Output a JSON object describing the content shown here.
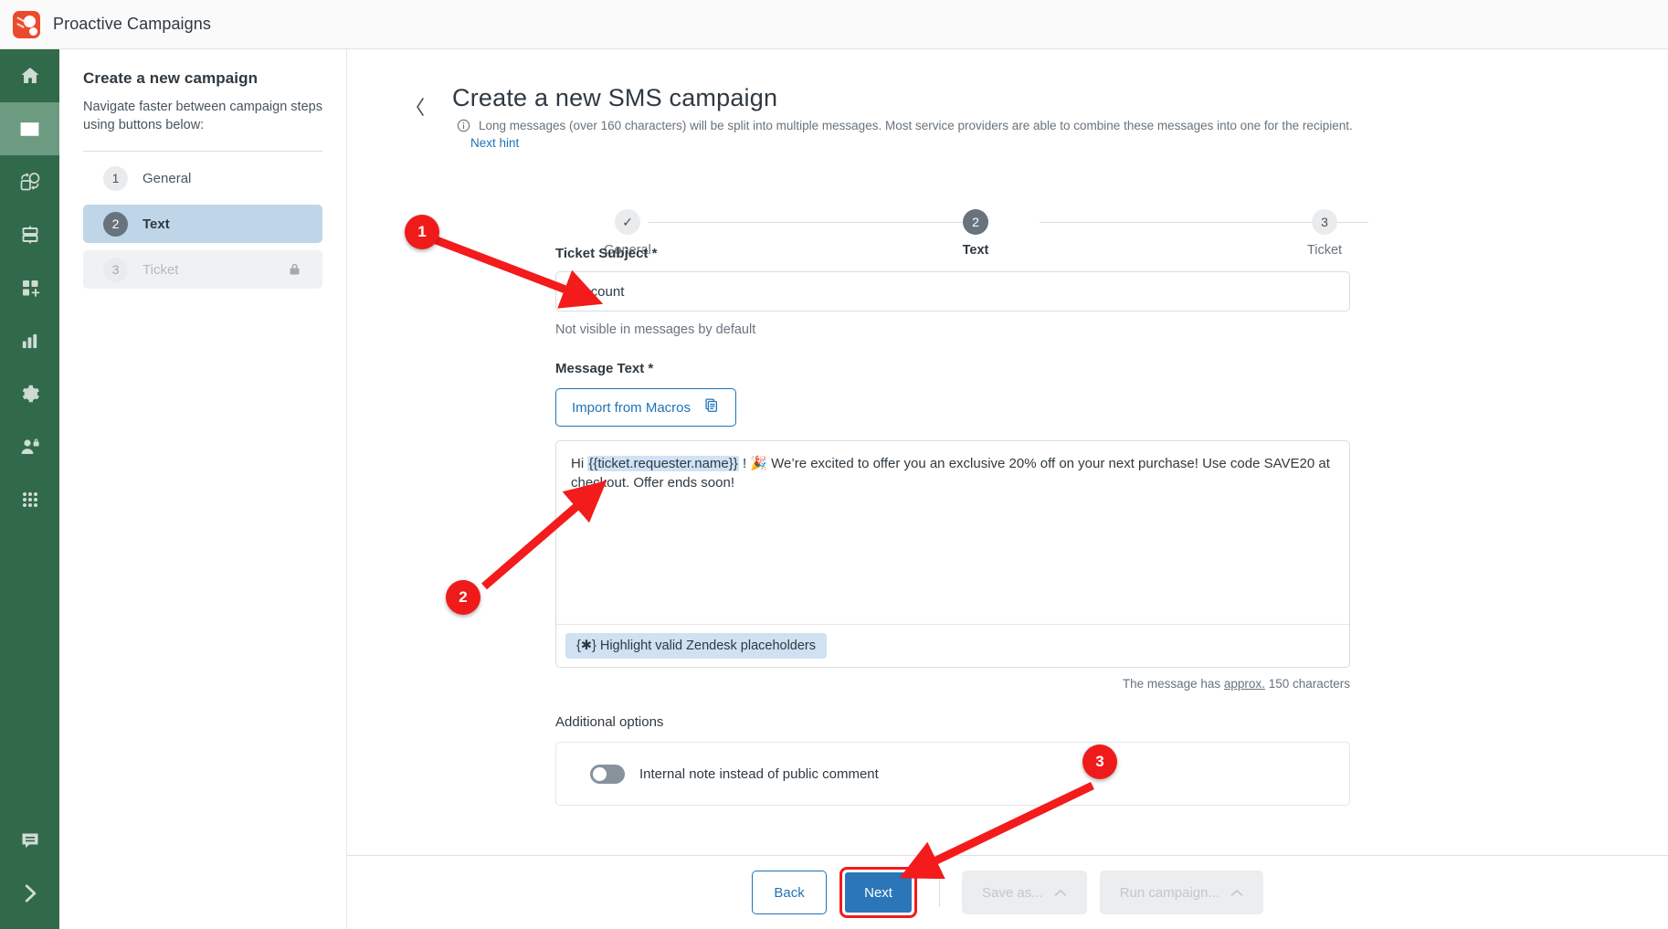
{
  "topbar": {
    "title": "Proactive Campaigns",
    "logo_icon": "proactive-campaigns-logo"
  },
  "rail": {
    "items": [
      {
        "icon": "home-icon",
        "name": "home"
      },
      {
        "icon": "envelope-icon",
        "name": "campaigns"
      },
      {
        "icon": "automation-icon",
        "name": "automations"
      },
      {
        "icon": "database-icon",
        "name": "data"
      },
      {
        "icon": "add-apps-icon",
        "name": "add-apps"
      },
      {
        "icon": "bar-chart-icon",
        "name": "reports"
      },
      {
        "icon": "gear-icon",
        "name": "settings"
      },
      {
        "icon": "user-lock-icon",
        "name": "permissions"
      },
      {
        "icon": "grid-dots-icon",
        "name": "apps"
      }
    ],
    "bottom": [
      {
        "icon": "chat-icon",
        "name": "support-chat"
      },
      {
        "icon": "chevron-right-icon",
        "name": "expand-sidebar"
      }
    ]
  },
  "subnav": {
    "heading": "Create a new campaign",
    "description": "Navigate faster between campaign steps using buttons below:",
    "steps": [
      {
        "num": "1",
        "label": "General",
        "state": "done"
      },
      {
        "num": "2",
        "label": "Text",
        "state": "active"
      },
      {
        "num": "3",
        "label": "Ticket",
        "state": "locked",
        "icon": "lock-icon"
      }
    ]
  },
  "main": {
    "back_icon": "chevron-left-icon",
    "title": "Create a new SMS campaign",
    "hint_icon": "info-icon",
    "hint": "Long messages (over 160 characters) will be split into multiple messages. Most service providers are able to combine these messages into one for the recipient.",
    "hint_link": "Next hint",
    "stepper": [
      {
        "num": "✓",
        "label": "General",
        "state": "done"
      },
      {
        "num": "2",
        "label": "Text",
        "state": "current"
      },
      {
        "num": "3",
        "label": "Ticket",
        "state": "upcoming"
      }
    ],
    "subject": {
      "label": "Ticket Subject *",
      "value": "Discount",
      "placeholder": "Ticket Subject",
      "help": "Not visible in messages by default"
    },
    "message": {
      "label": "Message Text *",
      "macros_button": "Import from Macros",
      "macros_icon": "copy-icon",
      "text_before_placeholder": "Hi ",
      "placeholder_token": "{{ticket.requester.name}}",
      "text_after_placeholder": " ! 🎉 We’re excited to offer you an exclusive 20% off on your next purchase! Use code SAVE20 at checkout. Offer ends soon!",
      "highlight_pill": "Highlight valid Zendesk placeholders",
      "highlight_pill_icon": "curly-braces-icon",
      "char_count_prefix": "The message has ",
      "char_count_underlined": "approx.",
      "char_count_suffix": " 150 characters"
    },
    "additional_options": {
      "title": "Additional options",
      "toggle_label": "Internal note instead of public comment",
      "toggle_state": "off"
    }
  },
  "actionbar": {
    "back": "Back",
    "next": "Next",
    "save_as": "Save as...",
    "save_as_icon": "chevron-up-icon",
    "run_campaign": "Run campaign...",
    "run_campaign_icon": "chevron-up-icon"
  },
  "annotations": [
    {
      "num": "1",
      "target": "ticket-subject-input"
    },
    {
      "num": "2",
      "target": "message-text-editor"
    },
    {
      "num": "3",
      "target": "next-button"
    }
  ],
  "colors": {
    "rail_green": "#31694b",
    "accent_blue": "#1f73b7",
    "annotation_red": "#ef1b1b",
    "logo_red": "#eb4b2c"
  }
}
